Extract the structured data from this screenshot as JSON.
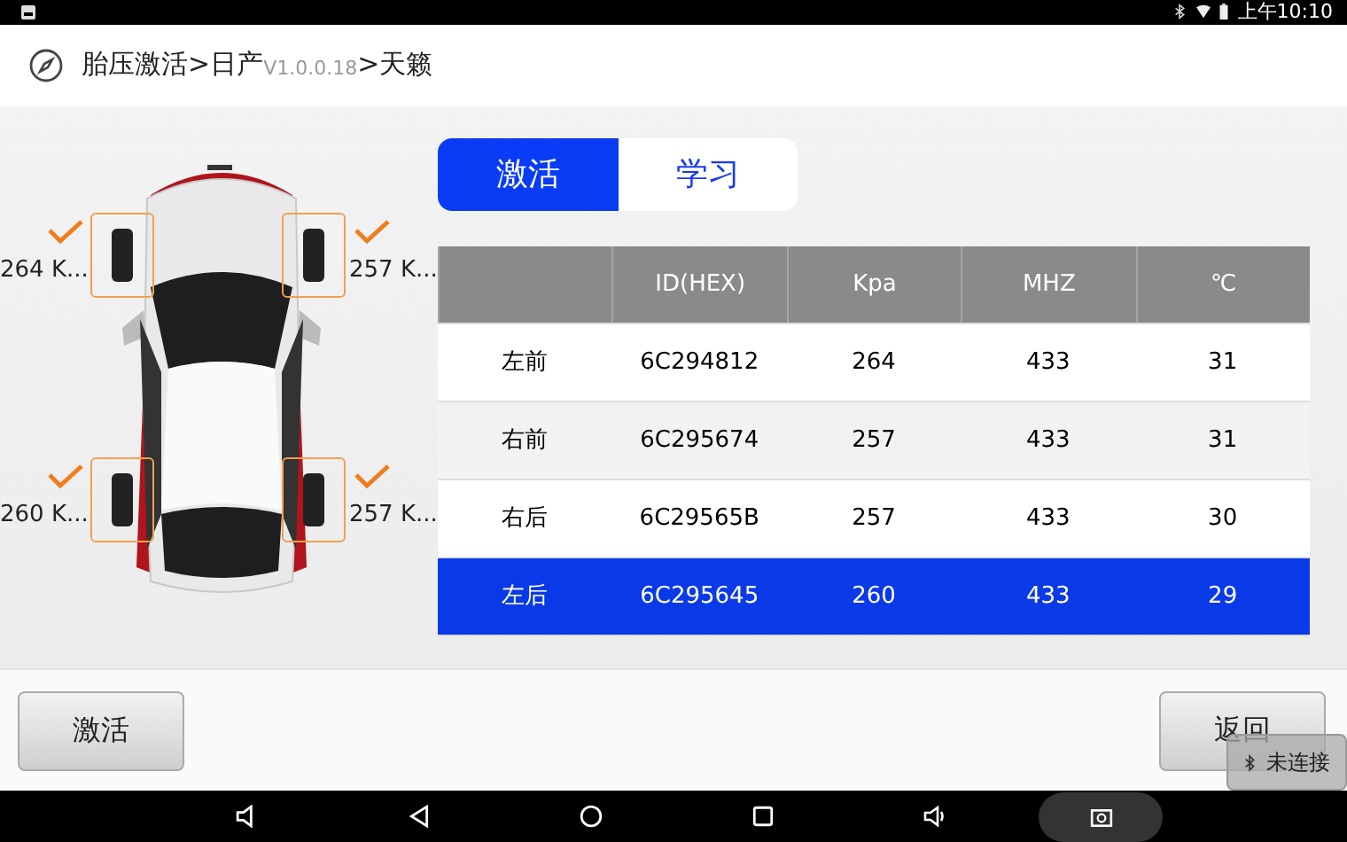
{
  "status_bar": {
    "time": "上午10:10"
  },
  "header": {
    "title_parts": [
      {
        "text": "胎压激活>日产",
        "kind": "path"
      },
      {
        "text": "V1.0.0.18",
        "kind": "version"
      },
      {
        "text": ">天籁",
        "kind": "path"
      }
    ]
  },
  "wheels": [
    {
      "reading": "264 K...",
      "checked": true
    },
    {
      "reading": "257 K...",
      "checked": true
    },
    {
      "reading": "260 K...",
      "checked": true
    },
    {
      "reading": "257 K...",
      "checked": true
    }
  ],
  "tabs": [
    {
      "label": "激活",
      "selected": true
    },
    {
      "label": "学习",
      "selected": false
    }
  ],
  "table": {
    "columns": [
      "",
      "ID(HEX)",
      "Kpa",
      "MHZ",
      "℃"
    ],
    "rows": [
      {
        "cells": [
          "左前",
          "6C294812",
          "264",
          "433",
          "31"
        ],
        "selected": false
      },
      {
        "cells": [
          "右前",
          "6C295674",
          "257",
          "433",
          "31"
        ],
        "selected": false
      },
      {
        "cells": [
          "右后",
          "6C29565B",
          "257",
          "433",
          "30"
        ],
        "selected": false
      },
      {
        "cells": [
          "左后",
          "6C295645",
          "260",
          "433",
          "29"
        ],
        "selected": true
      }
    ]
  },
  "buttons": [
    {
      "label": "激活"
    },
    {
      "label": "返回"
    }
  ],
  "toast": {
    "text": "未连接"
  }
}
